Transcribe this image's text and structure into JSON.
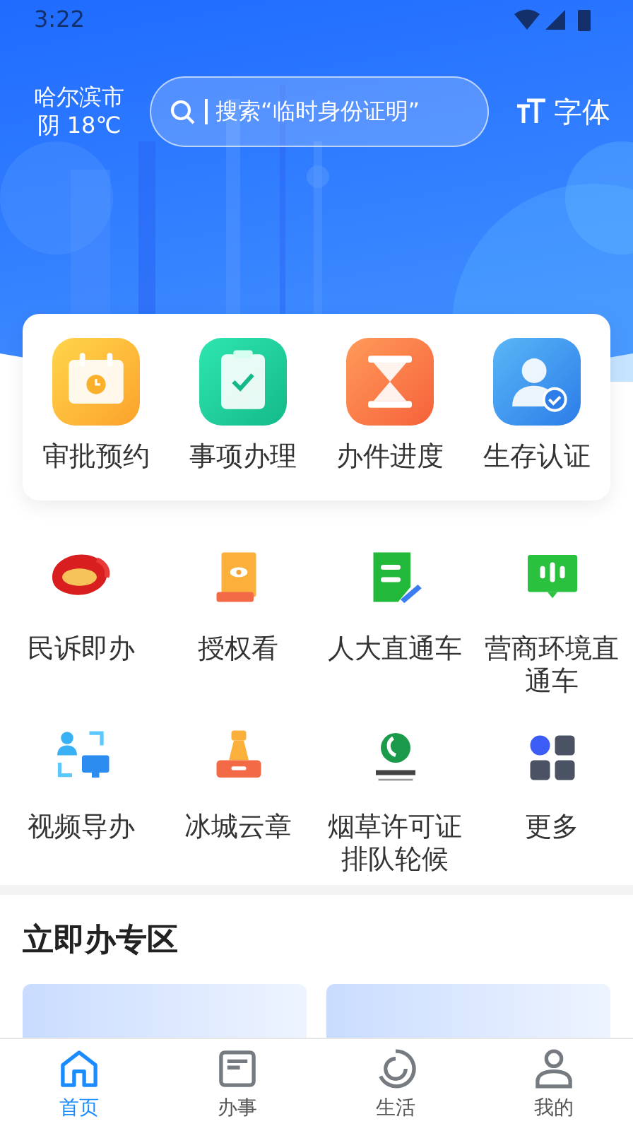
{
  "status_bar": {
    "time": "3:22"
  },
  "header": {
    "city": "哈尔滨市",
    "weather": "阴 18℃",
    "search": {
      "placeholder": "搜索“临时身份证明”"
    },
    "font_button": "字体"
  },
  "quick_actions": [
    {
      "label": "审批预约"
    },
    {
      "label": "事项办理"
    },
    {
      "label": "办件进度"
    },
    {
      "label": "生存认证"
    }
  ],
  "services": [
    {
      "label": "民诉即办"
    },
    {
      "label": "授权看"
    },
    {
      "label": "人大直通车"
    },
    {
      "label": "营商环境直通车"
    },
    {
      "label": "视频导办"
    },
    {
      "label": "冰城云章"
    },
    {
      "label": "烟草许可证排队轮候"
    },
    {
      "label": "更多"
    }
  ],
  "section": {
    "title": "立即办专区"
  },
  "bottom_nav": [
    {
      "label": "首页",
      "selected": true
    },
    {
      "label": "办事",
      "selected": false
    },
    {
      "label": "生活",
      "selected": false
    },
    {
      "label": "我的",
      "selected": false
    }
  ]
}
